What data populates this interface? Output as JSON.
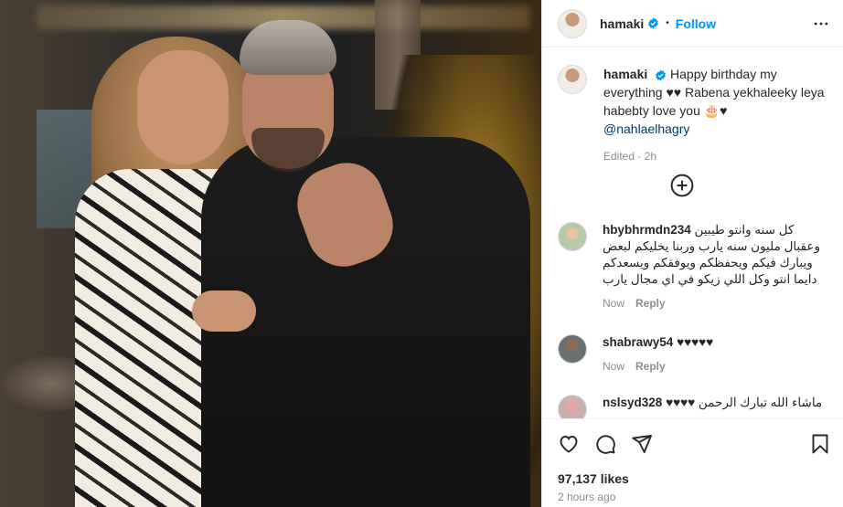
{
  "post": {
    "username": "hamaki",
    "follow_label": "Follow",
    "separator": "•"
  },
  "caption": {
    "username": "hamaki",
    "text": "Happy birthday my everything ♥♥ Rabena yekhaleeky leya habebty love you 🎂♥",
    "mention": "@nahlaelhagry",
    "edited": "Edited · 2h"
  },
  "comments": [
    {
      "username": "hbybhrmdn234",
      "text": "كل سنه وانتو طيبين وعقبال مليون سنه يارب وربنا يخليكم لبعض ويبارك فيكم ويحفظكم ويوفقكم ويسعدكم دايما انتو وكل اللي زيكو في اي مجال يارب",
      "time": "Now",
      "reply": "Reply"
    },
    {
      "username": "shabrawy54",
      "text": "♥♥♥♥♥",
      "time": "Now",
      "reply": "Reply"
    },
    {
      "username": "nslsyd328",
      "text": "♥♥♥♥ ماشاء الله تبارك الرحمن",
      "time": "",
      "reply": ""
    }
  ],
  "footer": {
    "likes": "97,137 likes",
    "time": "2 hours ago"
  },
  "icons": {
    "more": "more-options-icon",
    "verified": "verified-badge-icon",
    "add": "add-circle-icon",
    "like": "heart-icon",
    "comment": "comment-icon",
    "share": "share-icon",
    "save": "bookmark-icon"
  },
  "colors": {
    "follow_blue": "#0095f6",
    "verified_blue": "#0095f6",
    "mention": "#00376b",
    "meta_gray": "#8e8e8e",
    "border": "#efefef"
  }
}
